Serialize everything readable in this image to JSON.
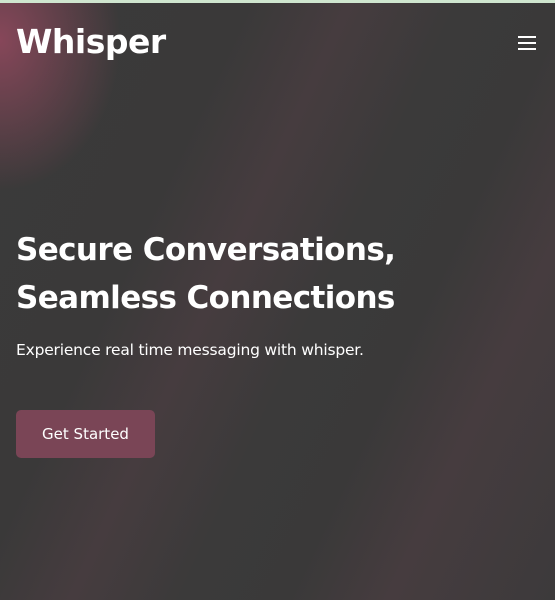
{
  "header": {
    "brand": "Whisper",
    "menu_icon": "hamburger-menu-icon"
  },
  "hero": {
    "title_line1": "Secure Conversations,",
    "title_line2": "Seamless Connections",
    "subtitle": "Experience real time messaging with whisper.",
    "cta_label": "Get Started"
  },
  "colors": {
    "background": "#3a3838",
    "accent": "#7a4556",
    "top_strip": "#cfe6cf"
  }
}
